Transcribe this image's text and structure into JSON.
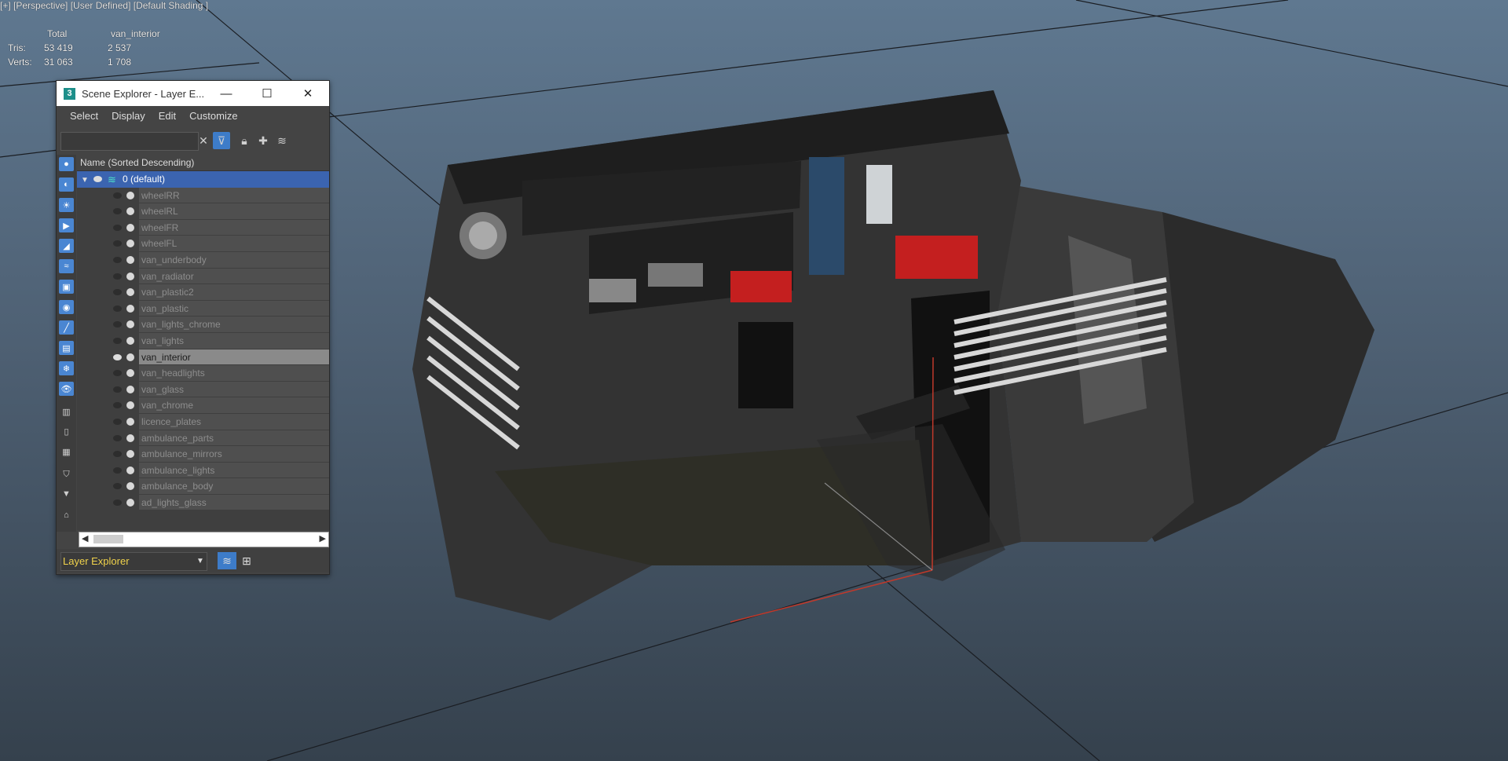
{
  "viewport": {
    "label": "[+] [Perspective] [User Defined] [Default Shading ]",
    "stats": {
      "headers": [
        "",
        "Total",
        "van_interior"
      ],
      "rows": [
        {
          "label": "Tris:",
          "total": "53 419",
          "selected": "2 537"
        },
        {
          "label": "Verts:",
          "total": "31 063",
          "selected": "1 708"
        }
      ]
    }
  },
  "explorer": {
    "title": "Scene Explorer - Layer E...",
    "app_icon": "3",
    "window_buttons": {
      "minimize": "—",
      "maximize": "☐",
      "close": "✕"
    },
    "menu": [
      "Select",
      "Display",
      "Edit",
      "Customize"
    ],
    "search": {
      "value": "",
      "placeholder": ""
    },
    "column_header": "Name (Sorted Descending)",
    "layer": {
      "name": "0 (default)"
    },
    "objects": [
      {
        "name": "wheelRR",
        "visible": false
      },
      {
        "name": "wheelRL",
        "visible": false
      },
      {
        "name": "wheelFR",
        "visible": false
      },
      {
        "name": "wheelFL",
        "visible": false
      },
      {
        "name": "van_underbody",
        "visible": false
      },
      {
        "name": "van_radiator",
        "visible": false
      },
      {
        "name": "van_plastic2",
        "visible": false
      },
      {
        "name": "van_plastic",
        "visible": false
      },
      {
        "name": "van_lights_chrome",
        "visible": false
      },
      {
        "name": "van_lights",
        "visible": false
      },
      {
        "name": "van_interior",
        "visible": true,
        "selected": true
      },
      {
        "name": "van_headlights",
        "visible": false
      },
      {
        "name": "van_glass",
        "visible": false
      },
      {
        "name": "van_chrome",
        "visible": false
      },
      {
        "name": "licence_plates",
        "visible": false
      },
      {
        "name": "ambulance_parts",
        "visible": false
      },
      {
        "name": "ambulance_mirrors",
        "visible": false
      },
      {
        "name": "ambulance_lights",
        "visible": false
      },
      {
        "name": "ambulance_body",
        "visible": false
      },
      {
        "name": "ad_lights_glass",
        "visible": false
      }
    ],
    "bottom_dropdown": "Layer Explorer",
    "colors": {
      "accent": "#3d7cc9",
      "selected_layer": "#3b64b0",
      "dropdown_text": "#f0d24b"
    }
  }
}
